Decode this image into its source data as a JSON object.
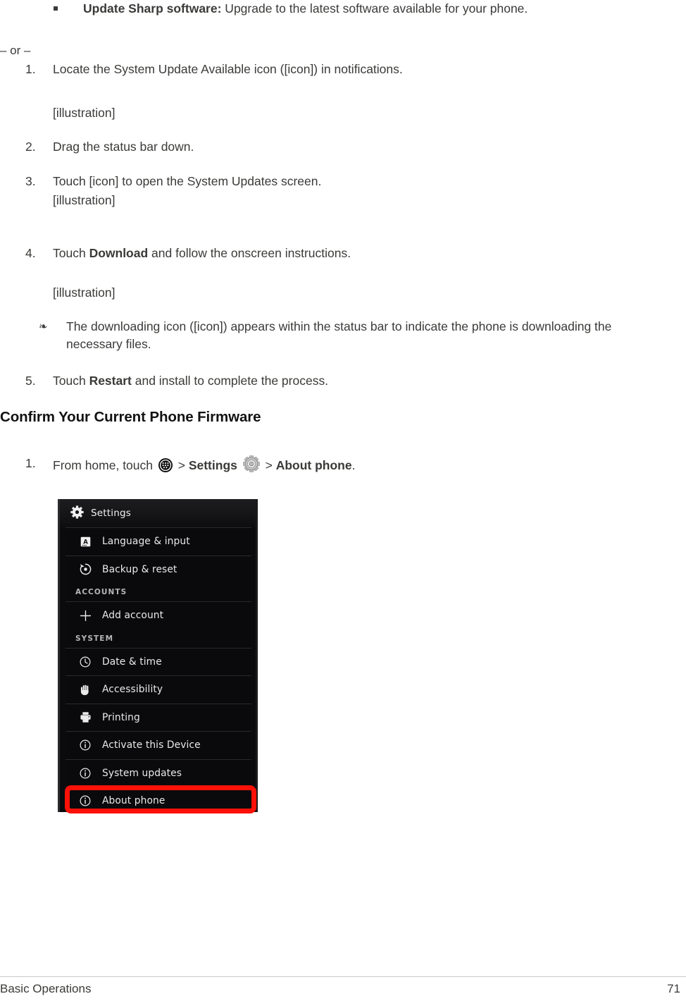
{
  "document": {
    "bullet_item": {
      "term": "Update Sharp software:",
      "description": " Upgrade to the latest software available for your phone."
    },
    "or_separator": "– or –",
    "steps_alt": [
      {
        "num": "1.",
        "text": "Locate the System Update Available icon ([icon]) in notifications."
      },
      {
        "num": "2.",
        "text": "Drag the status bar down."
      },
      {
        "num": "3.",
        "text": "Touch [icon] to open the System Updates screen."
      },
      {
        "num": "4.",
        "pre": "Touch ",
        "bold": "Download",
        "post": " and follow the onscreen instructions."
      },
      {
        "num": "5.",
        "pre": "Touch ",
        "bold": "Restart",
        "post": " and install to complete the process."
      }
    ],
    "illustration_placeholder": "[illustration]",
    "note": "The downloading icon ([icon]) appears within the status bar to indicate the phone is downloading the necessary files.",
    "heading": "Confirm Your Current Phone Firmware",
    "confirm_step": {
      "num": "1.",
      "part1": "From home, touch ",
      "sep1": " > ",
      "settings": "Settings",
      "sep2": " > ",
      "about": "About phone",
      "period": "."
    }
  },
  "screenshot": {
    "header_title": "Settings",
    "header_icon": "gear-icon",
    "items": [
      {
        "type": "row",
        "icon": "language-icon",
        "label": "Language & input"
      },
      {
        "type": "row",
        "icon": "backup-reset-icon",
        "label": "Backup & reset"
      },
      {
        "type": "category",
        "label": "ACCOUNTS"
      },
      {
        "type": "row",
        "icon": "plus-icon",
        "label": "Add account"
      },
      {
        "type": "category",
        "label": "SYSTEM"
      },
      {
        "type": "row",
        "icon": "clock-icon",
        "label": "Date & time"
      },
      {
        "type": "row",
        "icon": "hand-icon",
        "label": "Accessibility"
      },
      {
        "type": "row",
        "icon": "printer-icon",
        "label": "Printing"
      },
      {
        "type": "row",
        "icon": "info-icon",
        "label": "Activate this Device"
      },
      {
        "type": "row",
        "icon": "info-icon",
        "label": "System updates"
      },
      {
        "type": "row",
        "icon": "info-icon",
        "label": "About phone",
        "highlighted": true
      }
    ],
    "highlight_color": "#fc1108"
  },
  "footer": {
    "left": "Basic Operations",
    "page_number": "71"
  },
  "colors": {
    "body_text": "#3a3a38",
    "heading_text": "#121212",
    "highlight": "#fc1108"
  }
}
